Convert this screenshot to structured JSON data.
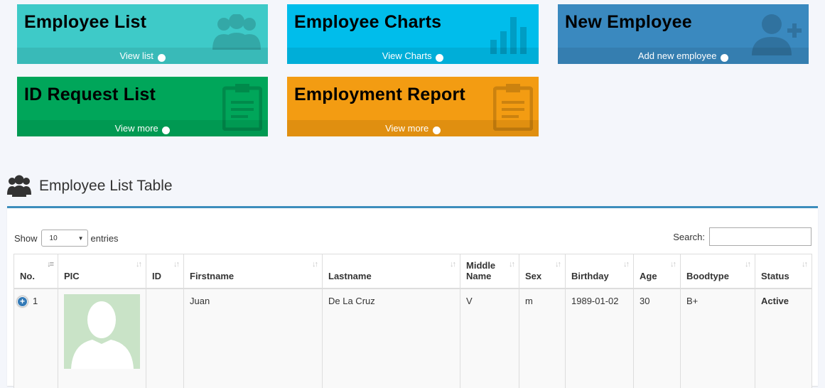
{
  "tiles": [
    {
      "title": "Employee List",
      "link": "View list",
      "icon": "users-icon",
      "color": "#3ecac8"
    },
    {
      "title": "Employee Charts",
      "link": "View Charts",
      "icon": "bar-chart-icon",
      "color": "#00bdeb"
    },
    {
      "title": "New Employee",
      "link": "Add new employee",
      "icon": "user-plus-icon",
      "color": "#3a89bf"
    },
    {
      "title": "ID Request List",
      "link": "View more",
      "icon": "clipboard-icon",
      "color": "#00a65a"
    },
    {
      "title": "Employment Report",
      "link": "View more",
      "icon": "clipboard-icon",
      "color": "#f39c12"
    }
  ],
  "section": {
    "title": "Employee List Table",
    "icon": "users-icon"
  },
  "table_controls": {
    "show_label": "Show",
    "page_size": "10",
    "entries_label": "entries",
    "search_label": "Search:",
    "search_value": ""
  },
  "columns": [
    "No.",
    "PIC",
    "ID",
    "Firstname",
    "Lastname",
    "Middle Name",
    "Sex",
    "Birthday",
    "Age",
    "Boodtype",
    "Status"
  ],
  "rows": [
    {
      "no": "1",
      "id": "",
      "firstname": "Juan",
      "lastname": "De La Cruz",
      "middle": "V",
      "sex": "m",
      "birthday": "1989-01-02",
      "age": "30",
      "bloodtype": "B+",
      "status": "Active"
    }
  ],
  "colors": {
    "accent": "#3c8dbc",
    "expand_button": "#337ab7"
  }
}
